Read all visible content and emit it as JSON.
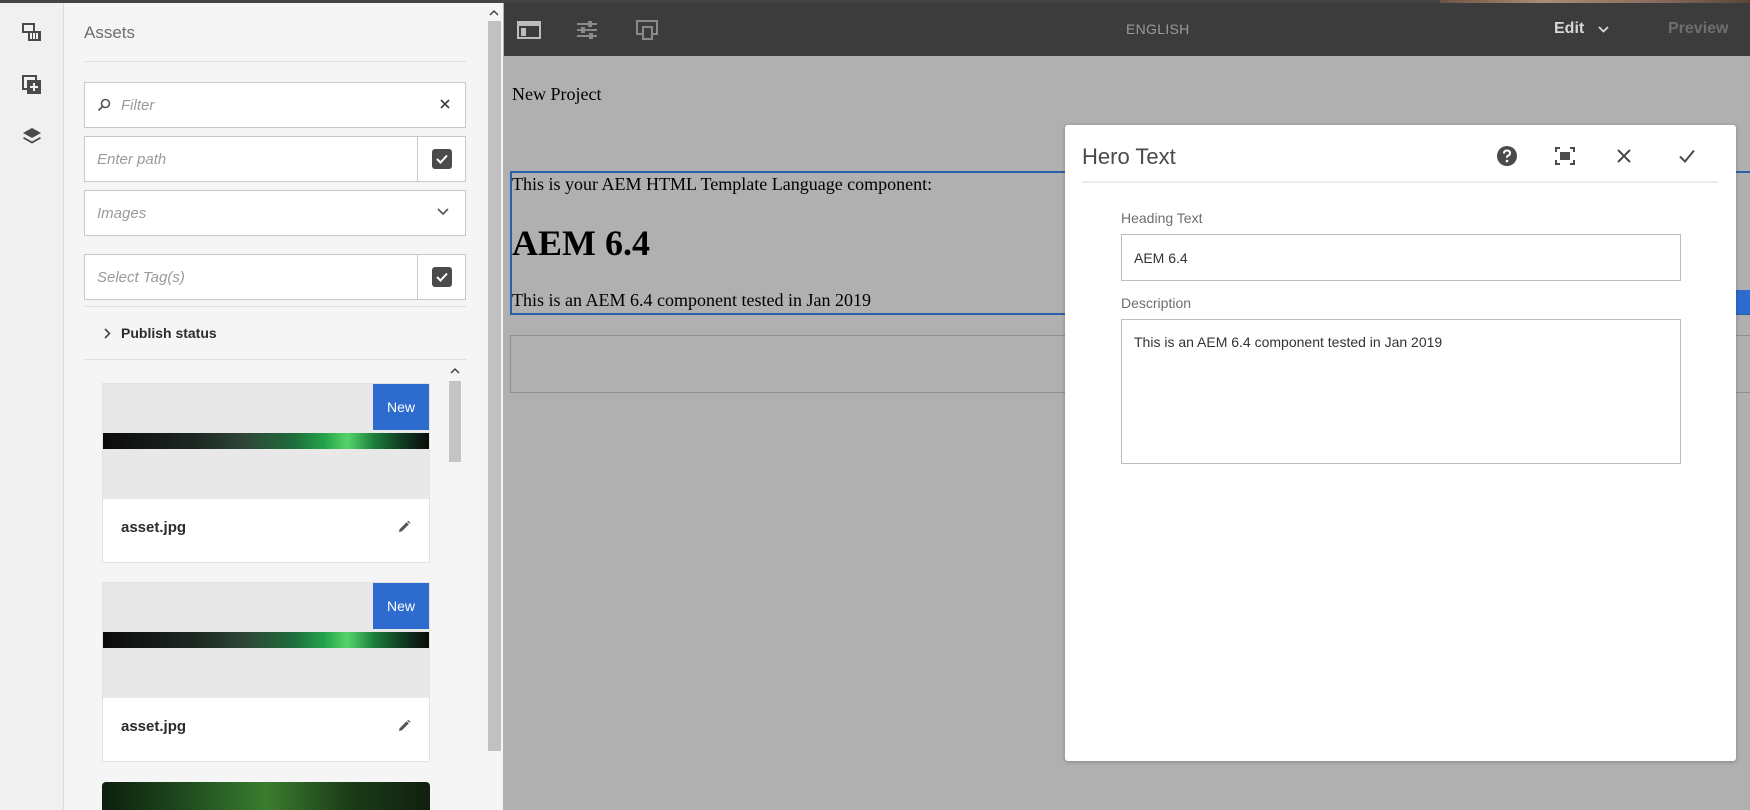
{
  "rail": {
    "items": [
      {
        "name": "assets-finder",
        "icon": "assets-icon"
      },
      {
        "name": "components",
        "icon": "add-component-icon"
      },
      {
        "name": "content-tree",
        "icon": "layers-icon"
      }
    ]
  },
  "side_panel": {
    "title": "Assets",
    "filter_placeholder": "Filter",
    "path_placeholder": "Enter path",
    "type_value": "Images",
    "tags_placeholder": "Select Tag(s)",
    "publish_status_label": "Publish status",
    "cards": [
      {
        "name": "asset.jpg",
        "badge": "New"
      },
      {
        "name": "asset.jpg",
        "badge": "New"
      }
    ]
  },
  "toolbar": {
    "language": "ENGLISH",
    "mode_label": "Edit",
    "preview_label": "Preview"
  },
  "canvas": {
    "page_title": "New Project",
    "intro": "This is your AEM HTML Template Language component:",
    "heading": "AEM 6.4",
    "description": "This is an AEM 6.4 component tested in Jan 2019"
  },
  "dialog": {
    "title": "Hero Text",
    "heading_label": "Heading Text",
    "heading_value": "AEM 6.4",
    "description_label": "Description",
    "description_value": "This is an AEM 6.4 component tested in Jan 2019"
  },
  "colors": {
    "accent": "#2d6bcf",
    "toolbar_bg": "#3c3c3c",
    "canvas_overlay": "#b0b0b0"
  }
}
